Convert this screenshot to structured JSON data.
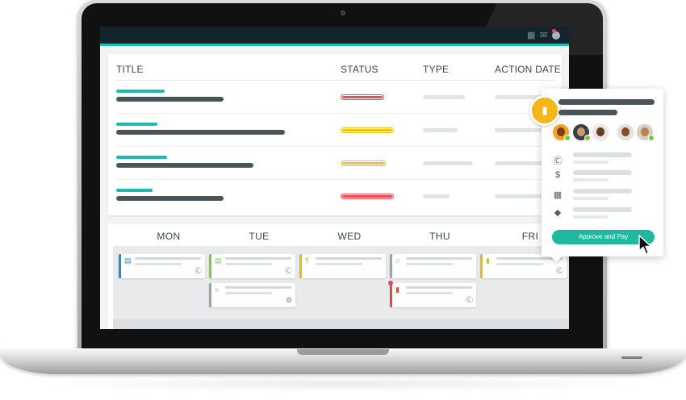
{
  "app": {
    "topbar": {
      "icons": [
        "calendar-icon",
        "mail-icon",
        "user-avatar-icon"
      ]
    },
    "table": {
      "columns": [
        "TITLE",
        "STATUS",
        "TYPE",
        "ACTION DATE"
      ],
      "rows": [
        {
          "status_color": "#e84e55"
        },
        {
          "status_color": "#f4c11e"
        },
        {
          "status_color": "#f4c11e"
        },
        {
          "status_color": "#e84e55"
        }
      ]
    },
    "calendar": {
      "days": [
        "MON",
        "TUE",
        "WED",
        "THU",
        "FRI"
      ],
      "events": [
        {
          "day": "MON",
          "color": "#1e8fd6",
          "icon": "document-icon"
        },
        {
          "day": "TUE",
          "color": "#7ac943",
          "icon": "document-icon"
        },
        {
          "day": "TUE",
          "color": "#9aa3a8",
          "icon": "lightbulb-icon"
        },
        {
          "day": "WED",
          "color": "#f4b619",
          "icon": "paragraph-icon"
        },
        {
          "day": "THU",
          "color": "#9aa3a8",
          "icon": "lightbulb-icon"
        },
        {
          "day": "THU",
          "color": "#e2474e",
          "icon": "book-icon"
        },
        {
          "day": "FRI",
          "color": "#f4b619",
          "icon": "book-icon"
        }
      ]
    }
  },
  "popover": {
    "icon": "book-icon",
    "meta_icons": [
      "wordpress-icon",
      "dollar-icon",
      "calendar-icon",
      "tag-icon"
    ],
    "button_label": "Approve and Pay"
  },
  "colors": {
    "accent": "#1fb9ad",
    "title_bar": "#1fb9ad",
    "text_bar": "#4a5358",
    "button": "#1fb9a0"
  }
}
